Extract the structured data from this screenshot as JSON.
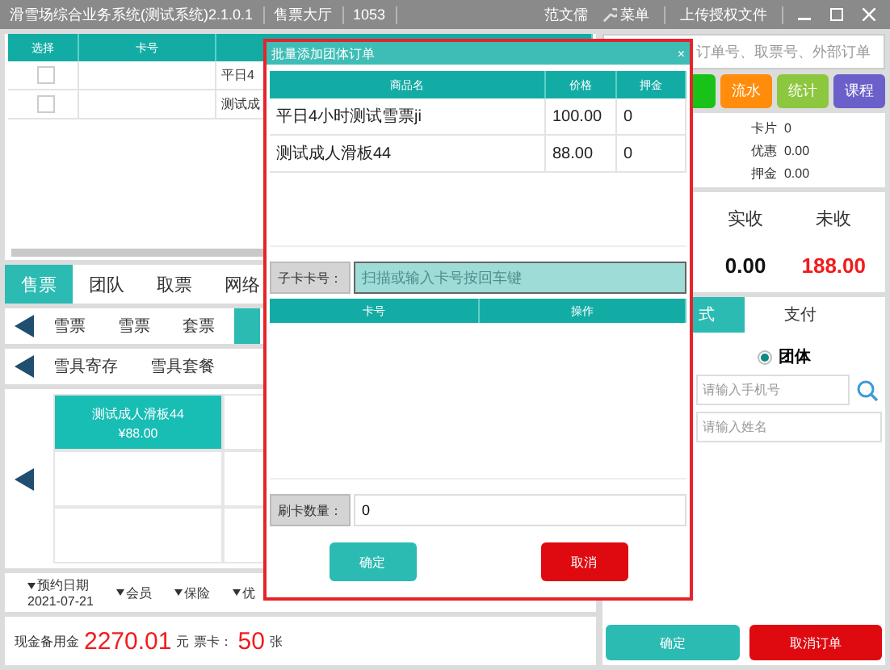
{
  "window": {
    "title": "滑雪场综合业务系统(测试系统)2.1.0.1",
    "hall": "售票大厅",
    "terminal": "1053",
    "user": "范文儒",
    "menu": "菜单",
    "upload": "上传授权文件"
  },
  "order_table": {
    "columns": [
      "选择",
      "卡号"
    ],
    "rows": [
      {
        "checked": false,
        "column_3": "平日4"
      },
      {
        "checked": false,
        "column_3": "测试成"
      }
    ]
  },
  "main_tabs": [
    {
      "label": "售票",
      "selected": true
    },
    {
      "label": "团队",
      "selected": false
    },
    {
      "label": "取票",
      "selected": false
    },
    {
      "label": "网络",
      "selected": false
    }
  ],
  "categories": [
    {
      "label": "雪票",
      "selected": false
    },
    {
      "label": "雪票",
      "selected": false
    },
    {
      "label": "套票",
      "selected": false
    },
    {
      "selected": true
    }
  ],
  "categories_2": [
    "雪具寄存",
    "雪具套餐"
  ],
  "products": [
    {
      "name": "测试成人滑板44",
      "price": "¥88.00",
      "selected": true
    }
  ],
  "options": [
    {
      "label": "预约日期",
      "value": "2021-07-21"
    },
    {
      "label": "会员"
    },
    {
      "label": "保险"
    },
    {
      "label": "优"
    }
  ],
  "footer": {
    "cash_label": "现金备用金",
    "cash": "2270.01",
    "cash_unit": "元",
    "cards_label": "票卡：",
    "cards": "50",
    "cards_unit": "张"
  },
  "search": {
    "placeholder": "订单号、取票号、外部订单"
  },
  "actions": [
    {
      "color": "#19c219"
    },
    {
      "label": "流水",
      "color": "#ff8c0a"
    },
    {
      "label": "统计",
      "color": "#8dc63f"
    },
    {
      "label": "课程",
      "color": "#6b5fc9"
    }
  ],
  "summary": [
    {
      "label": "卡片",
      "value": "0"
    },
    {
      "label": "优惠",
      "value": "0.00"
    },
    {
      "label": "押金",
      "value": "0.00"
    }
  ],
  "totals": [
    {
      "label": "实收",
      "value": "0.00",
      "kind": "paid"
    },
    {
      "label": "未收",
      "value": "188.00",
      "kind": "due"
    }
  ],
  "pay_tabs": [
    {
      "label": "式",
      "selected": true
    },
    {
      "label": "支付",
      "selected": false
    }
  ],
  "customer": {
    "type": {
      "label": "团体",
      "selected": true
    },
    "phone_placeholder": "请输入手机号",
    "name_placeholder": "请输入姓名"
  },
  "buttons": [
    {
      "label": "确定",
      "kind": "confirm"
    },
    {
      "label": "取消订单",
      "kind": "cancel"
    }
  ],
  "dialog": {
    "title": "批量添加团体订单",
    "close": "×",
    "columns": [
      "商品名",
      "价格",
      "押金"
    ],
    "rows": [
      {
        "name": "平日4小时测试雪票ji",
        "price": "100.00",
        "deposit": "0"
      },
      {
        "name": "测试成人滑板44",
        "price": "88.00",
        "deposit": "0"
      }
    ],
    "card_label": "子卡卡号：",
    "card_placeholder": "扫描或输入卡号按回车键",
    "card_columns": [
      "卡号",
      "操作"
    ],
    "count_label": "刷卡数量：",
    "count": "0",
    "buttons": [
      {
        "label": "确定",
        "kind": "confirm"
      },
      {
        "label": "取消",
        "kind": "cancel"
      }
    ]
  }
}
